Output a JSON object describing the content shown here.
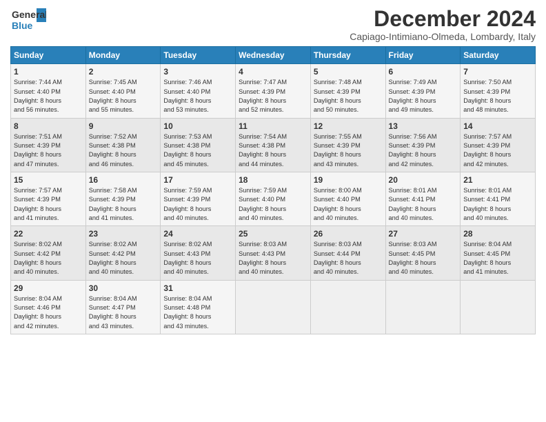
{
  "logo": {
    "general": "General",
    "blue": "Blue"
  },
  "title": "December 2024",
  "location": "Capiago-Intimiano-Olmeda, Lombardy, Italy",
  "days_header": [
    "Sunday",
    "Monday",
    "Tuesday",
    "Wednesday",
    "Thursday",
    "Friday",
    "Saturday"
  ],
  "weeks": [
    [
      {
        "day": "1",
        "info": "Sunrise: 7:44 AM\nSunset: 4:40 PM\nDaylight: 8 hours\nand 56 minutes."
      },
      {
        "day": "2",
        "info": "Sunrise: 7:45 AM\nSunset: 4:40 PM\nDaylight: 8 hours\nand 55 minutes."
      },
      {
        "day": "3",
        "info": "Sunrise: 7:46 AM\nSunset: 4:40 PM\nDaylight: 8 hours\nand 53 minutes."
      },
      {
        "day": "4",
        "info": "Sunrise: 7:47 AM\nSunset: 4:39 PM\nDaylight: 8 hours\nand 52 minutes."
      },
      {
        "day": "5",
        "info": "Sunrise: 7:48 AM\nSunset: 4:39 PM\nDaylight: 8 hours\nand 50 minutes."
      },
      {
        "day": "6",
        "info": "Sunrise: 7:49 AM\nSunset: 4:39 PM\nDaylight: 8 hours\nand 49 minutes."
      },
      {
        "day": "7",
        "info": "Sunrise: 7:50 AM\nSunset: 4:39 PM\nDaylight: 8 hours\nand 48 minutes."
      }
    ],
    [
      {
        "day": "8",
        "info": "Sunrise: 7:51 AM\nSunset: 4:39 PM\nDaylight: 8 hours\nand 47 minutes."
      },
      {
        "day": "9",
        "info": "Sunrise: 7:52 AM\nSunset: 4:38 PM\nDaylight: 8 hours\nand 46 minutes."
      },
      {
        "day": "10",
        "info": "Sunrise: 7:53 AM\nSunset: 4:38 PM\nDaylight: 8 hours\nand 45 minutes."
      },
      {
        "day": "11",
        "info": "Sunrise: 7:54 AM\nSunset: 4:38 PM\nDaylight: 8 hours\nand 44 minutes."
      },
      {
        "day": "12",
        "info": "Sunrise: 7:55 AM\nSunset: 4:39 PM\nDaylight: 8 hours\nand 43 minutes."
      },
      {
        "day": "13",
        "info": "Sunrise: 7:56 AM\nSunset: 4:39 PM\nDaylight: 8 hours\nand 42 minutes."
      },
      {
        "day": "14",
        "info": "Sunrise: 7:57 AM\nSunset: 4:39 PM\nDaylight: 8 hours\nand 42 minutes."
      }
    ],
    [
      {
        "day": "15",
        "info": "Sunrise: 7:57 AM\nSunset: 4:39 PM\nDaylight: 8 hours\nand 41 minutes."
      },
      {
        "day": "16",
        "info": "Sunrise: 7:58 AM\nSunset: 4:39 PM\nDaylight: 8 hours\nand 41 minutes."
      },
      {
        "day": "17",
        "info": "Sunrise: 7:59 AM\nSunset: 4:39 PM\nDaylight: 8 hours\nand 40 minutes."
      },
      {
        "day": "18",
        "info": "Sunrise: 7:59 AM\nSunset: 4:40 PM\nDaylight: 8 hours\nand 40 minutes."
      },
      {
        "day": "19",
        "info": "Sunrise: 8:00 AM\nSunset: 4:40 PM\nDaylight: 8 hours\nand 40 minutes."
      },
      {
        "day": "20",
        "info": "Sunrise: 8:01 AM\nSunset: 4:41 PM\nDaylight: 8 hours\nand 40 minutes."
      },
      {
        "day": "21",
        "info": "Sunrise: 8:01 AM\nSunset: 4:41 PM\nDaylight: 8 hours\nand 40 minutes."
      }
    ],
    [
      {
        "day": "22",
        "info": "Sunrise: 8:02 AM\nSunset: 4:42 PM\nDaylight: 8 hours\nand 40 minutes."
      },
      {
        "day": "23",
        "info": "Sunrise: 8:02 AM\nSunset: 4:42 PM\nDaylight: 8 hours\nand 40 minutes."
      },
      {
        "day": "24",
        "info": "Sunrise: 8:02 AM\nSunset: 4:43 PM\nDaylight: 8 hours\nand 40 minutes."
      },
      {
        "day": "25",
        "info": "Sunrise: 8:03 AM\nSunset: 4:43 PM\nDaylight: 8 hours\nand 40 minutes."
      },
      {
        "day": "26",
        "info": "Sunrise: 8:03 AM\nSunset: 4:44 PM\nDaylight: 8 hours\nand 40 minutes."
      },
      {
        "day": "27",
        "info": "Sunrise: 8:03 AM\nSunset: 4:45 PM\nDaylight: 8 hours\nand 40 minutes."
      },
      {
        "day": "28",
        "info": "Sunrise: 8:04 AM\nSunset: 4:45 PM\nDaylight: 8 hours\nand 41 minutes."
      }
    ],
    [
      {
        "day": "29",
        "info": "Sunrise: 8:04 AM\nSunset: 4:46 PM\nDaylight: 8 hours\nand 42 minutes."
      },
      {
        "day": "30",
        "info": "Sunrise: 8:04 AM\nSunset: 4:47 PM\nDaylight: 8 hours\nand 43 minutes."
      },
      {
        "day": "31",
        "info": "Sunrise: 8:04 AM\nSunset: 4:48 PM\nDaylight: 8 hours\nand 43 minutes."
      },
      null,
      null,
      null,
      null
    ]
  ]
}
